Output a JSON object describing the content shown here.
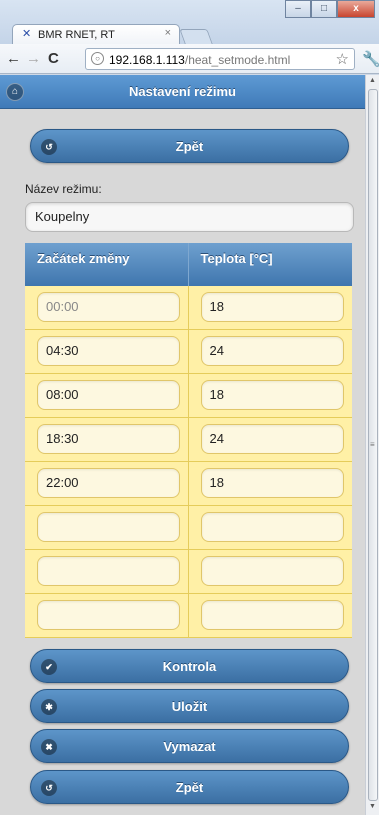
{
  "browser": {
    "tab_title": "BMR RNET, RT",
    "tab_close": "×",
    "url_host": "192.168.1.113",
    "url_path": "/heat_setmode.html",
    "icons": [
      "favicon-icon",
      "back-icon",
      "forward-icon",
      "reload-icon",
      "page-icon",
      "star-icon",
      "wrench-icon",
      "minimize-icon",
      "maximize-icon",
      "close-icon"
    ],
    "window_buttons": {
      "minimize": "–",
      "maximize": "□",
      "close": "x"
    }
  },
  "header": {
    "title": "Nastavení režimu",
    "home_icon": "home-icon"
  },
  "buttons": {
    "back_top": {
      "label": "Zpět",
      "icon": "back-arrow-icon"
    },
    "check": {
      "label": "Kontrola",
      "icon": "check-icon"
    },
    "save": {
      "label": "Uložit",
      "icon": "gear-icon"
    },
    "delete": {
      "label": "Vymazat",
      "icon": "delete-icon"
    },
    "back_bottom": {
      "label": "Zpět",
      "icon": "back-arrow-icon"
    }
  },
  "form": {
    "name_label": "Název režimu:",
    "name_value": "Koupelny"
  },
  "table": {
    "headers": [
      "Začátek změny",
      "Teplota [°C]"
    ],
    "rows": [
      {
        "start": "00:00",
        "temp": "18"
      },
      {
        "start": "04:30",
        "temp": "24"
      },
      {
        "start": "08:00",
        "temp": "18"
      },
      {
        "start": "18:30",
        "temp": "24"
      },
      {
        "start": "22:00",
        "temp": "18"
      },
      {
        "start": "",
        "temp": ""
      },
      {
        "start": "",
        "temp": ""
      },
      {
        "start": "",
        "temp": ""
      }
    ]
  },
  "colors": {
    "header_blue": "#4a86c4",
    "button_blue": "#3b6fa3",
    "table_row": "#fff0a6"
  }
}
